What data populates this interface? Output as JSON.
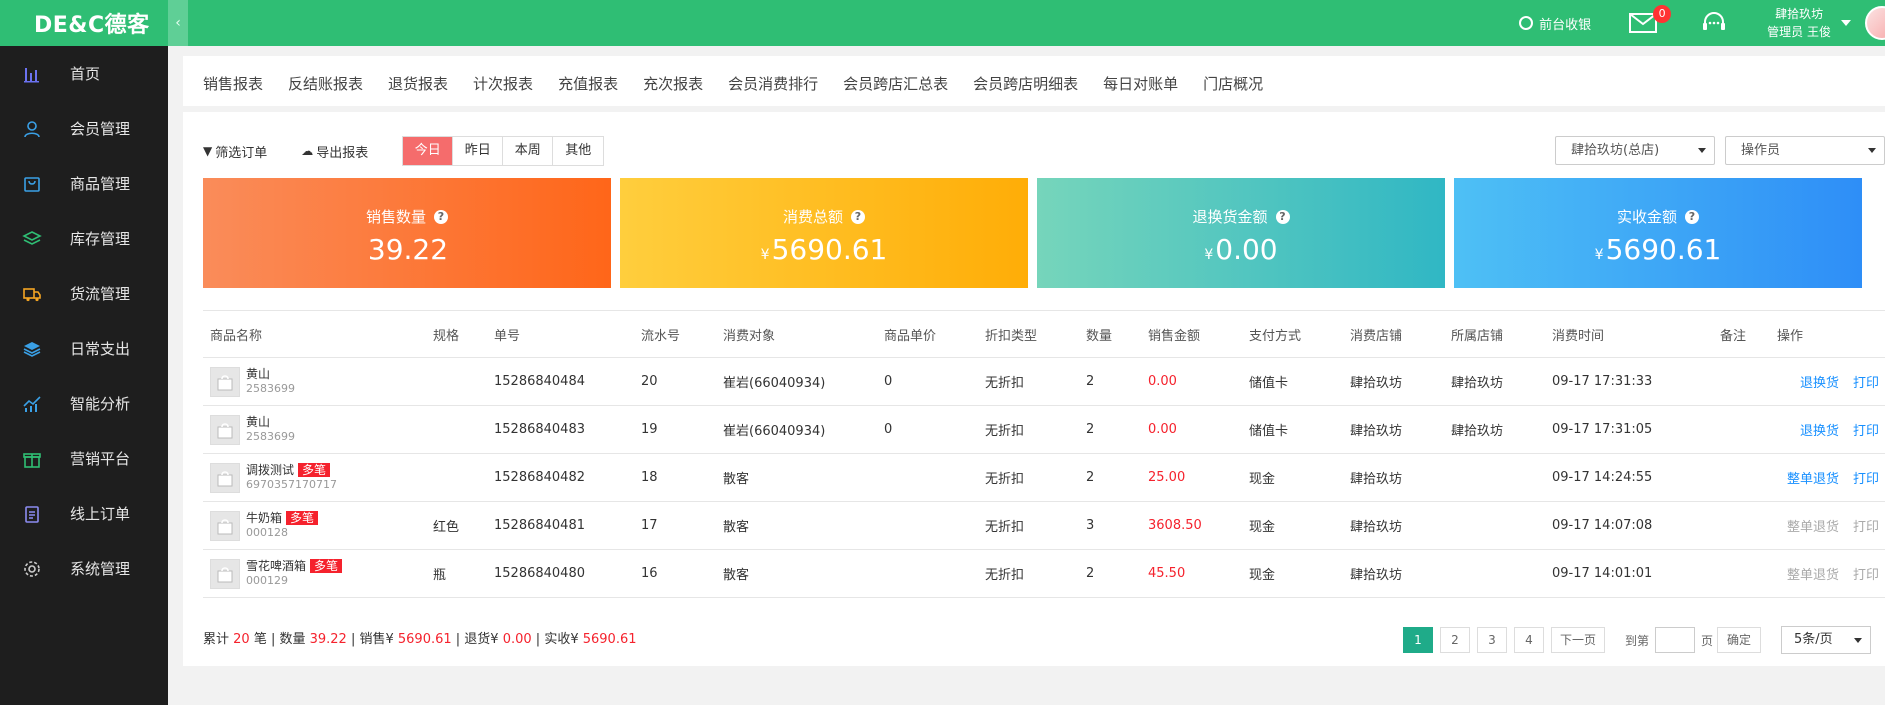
{
  "app": {
    "logo": "DE&C德客",
    "collapse": "‹"
  },
  "header": {
    "cashier": "前台收银",
    "mail_count": "0",
    "store_name": "肆拾玖坊",
    "user_line": "管理员 王俊"
  },
  "sidebar": {
    "items": [
      {
        "label": "首页",
        "icon": "bar-chart-icon",
        "color": "#6b72f0"
      },
      {
        "label": "会员管理",
        "icon": "user-icon",
        "color": "#3aa0e6"
      },
      {
        "label": "商品管理",
        "icon": "bag-icon",
        "color": "#3aa0e6"
      },
      {
        "label": "库存管理",
        "icon": "layers-icon",
        "color": "#2fbe74"
      },
      {
        "label": "货流管理",
        "icon": "truck-icon",
        "color": "#f5a623"
      },
      {
        "label": "日常支出",
        "icon": "stack-icon",
        "color": "#3aa0e6"
      },
      {
        "label": "智能分析",
        "icon": "analytics-icon",
        "color": "#3aa0e6"
      },
      {
        "label": "营销平台",
        "icon": "gift-icon",
        "color": "#2fbe74"
      },
      {
        "label": "线上订单",
        "icon": "clipboard-icon",
        "color": "#8c8cf0"
      },
      {
        "label": "系统管理",
        "icon": "gear-icon",
        "color": "#cccccc"
      }
    ]
  },
  "tabs": [
    "销售报表",
    "反结账报表",
    "退货报表",
    "计次报表",
    "充值报表",
    "充次报表",
    "会员消费排行",
    "会员跨店汇总表",
    "会员跨店明细表",
    "每日对账单",
    "门店概况"
  ],
  "toolbar": {
    "filter": "筛选订单",
    "export": "导出报表",
    "periods": [
      "今日",
      "昨日",
      "本周",
      "其他"
    ],
    "store_select": "肆拾玖坊(总店)",
    "operator_select": "操作员"
  },
  "cards": [
    {
      "title": "销售数量",
      "value": "39.22",
      "currency": ""
    },
    {
      "title": "消费总额",
      "value": "5690.61",
      "currency": "¥"
    },
    {
      "title": "退换货金额",
      "value": "0.00",
      "currency": "¥"
    },
    {
      "title": "实收金额",
      "value": "5690.61",
      "currency": "¥"
    }
  ],
  "table": {
    "headers": [
      "商品名称",
      "规格",
      "单号",
      "流水号",
      "消费对象",
      "商品单价",
      "折扣类型",
      "数量",
      "销售金额",
      "支付方式",
      "消费店铺",
      "所属店铺",
      "消费时间",
      "备注",
      "操作"
    ],
    "rows": [
      {
        "name": "黄山",
        "code": "2583699",
        "multi": "",
        "spec": "",
        "order": "15286840484",
        "serial": "20",
        "customer": "崔岩(66040934)",
        "price": "0",
        "discount": "无折扣",
        "qty": "2",
        "amount": "0.00",
        "payment": "储值卡",
        "store": "肆拾玖坊",
        "home_store": "肆拾玖坊",
        "time": "09-17 17:31:33",
        "note": "",
        "op1": "退换货",
        "op2": "打印",
        "enabled": true
      },
      {
        "name": "黄山",
        "code": "2583699",
        "multi": "",
        "spec": "",
        "order": "15286840483",
        "serial": "19",
        "customer": "崔岩(66040934)",
        "price": "0",
        "discount": "无折扣",
        "qty": "2",
        "amount": "0.00",
        "payment": "储值卡",
        "store": "肆拾玖坊",
        "home_store": "肆拾玖坊",
        "time": "09-17 17:31:05",
        "note": "",
        "op1": "退换货",
        "op2": "打印",
        "enabled": true
      },
      {
        "name": "调拨测试",
        "code": "6970357170717",
        "multi": "多笔",
        "spec": "",
        "order": "15286840482",
        "serial": "18",
        "customer": "散客",
        "price": "",
        "discount": "无折扣",
        "qty": "2",
        "amount": "25.00",
        "payment": "现金",
        "store": "肆拾玖坊",
        "home_store": "",
        "time": "09-17 14:24:55",
        "note": "",
        "op1": "整单退货",
        "op2": "打印",
        "enabled": true
      },
      {
        "name": "牛奶箱",
        "code": "000128",
        "multi": "多笔",
        "spec": "红色",
        "order": "15286840481",
        "serial": "17",
        "customer": "散客",
        "price": "",
        "discount": "无折扣",
        "qty": "3",
        "amount": "3608.50",
        "payment": "现金",
        "store": "肆拾玖坊",
        "home_store": "",
        "time": "09-17 14:07:08",
        "note": "",
        "op1": "整单退货",
        "op2": "打印",
        "enabled": false
      },
      {
        "name": "雪花啤酒箱",
        "code": "000129",
        "multi": "多笔",
        "spec": "瓶",
        "order": "15286840480",
        "serial": "16",
        "customer": "散客",
        "price": "",
        "discount": "无折扣",
        "qty": "2",
        "amount": "45.50",
        "payment": "现金",
        "store": "肆拾玖坊",
        "home_store": "",
        "time": "09-17 14:01:01",
        "note": "",
        "op1": "整单退货",
        "op2": "打印",
        "enabled": false
      }
    ]
  },
  "summary": {
    "p1": "累计 ",
    "count": "20",
    "p2": " 笔 | 数量 ",
    "qty": "39.22",
    "p3": " | 销售¥ ",
    "sales": "5690.61",
    "p4": " | 退货¥ ",
    "returns": "0.00",
    "p5": " | 实收¥ ",
    "received": "5690.61"
  },
  "pager": {
    "pages": [
      "1",
      "2",
      "3",
      "4"
    ],
    "next": "下一页",
    "goto_prefix": "到第",
    "goto_suffix": "页",
    "confirm": "确定",
    "page_size": "5条/页"
  },
  "colors": {
    "brand": "#2fbe74",
    "sidebar": "#1e1e1e",
    "accent_red": "#f5222d",
    "link": "#1890ff"
  }
}
